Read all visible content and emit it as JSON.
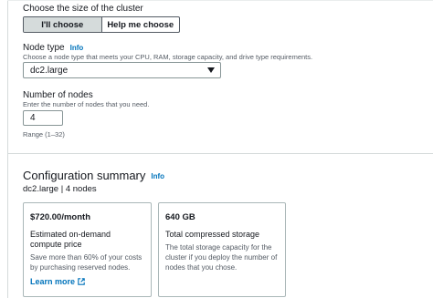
{
  "size_section": {
    "label": "Choose the size of the cluster",
    "options": [
      "I'll choose",
      "Help me choose"
    ],
    "selected": "I'll choose"
  },
  "node_type": {
    "label": "Node type",
    "info": "Info",
    "description": "Choose a node type that meets your CPU, RAM, storage capacity, and drive type requirements.",
    "value": "dc2.large"
  },
  "num_nodes": {
    "label": "Number of nodes",
    "description": "Enter the number of nodes that you need.",
    "value": "4",
    "range": "Range (1–32)"
  },
  "summary": {
    "title": "Configuration summary",
    "info": "Info",
    "subtitle": "dc2.large | 4 nodes",
    "cards": [
      {
        "value": "$720.00/month",
        "title": "Estimated on-demand compute price",
        "text": "Save more than 60% of your costs by purchasing reserved nodes.",
        "link": "Learn more"
      },
      {
        "value": "640 GB",
        "title": "Total compressed storage",
        "text": "The total storage capacity for the cluster if you deploy the number of nodes that you chose."
      }
    ]
  }
}
